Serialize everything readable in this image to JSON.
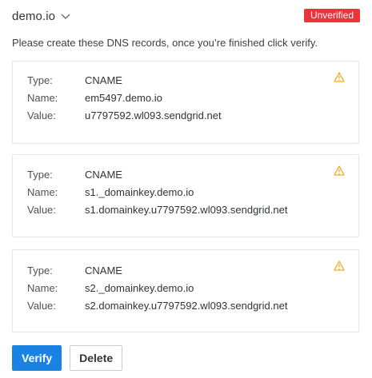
{
  "header": {
    "domain": "demo.io",
    "status_badge": "Unverified",
    "status_color": "#e8343a"
  },
  "instructions": "Please create these DNS records, once you’re finished click verify.",
  "labels": {
    "type": "Type:",
    "name": "Name:",
    "value": "Value:"
  },
  "records": [
    {
      "type": "CNAME",
      "name": "em5497.demo.io",
      "value": "u7797592.wl093.sendgrid.net",
      "warning_icon": "warning-triangle"
    },
    {
      "type": "CNAME",
      "name": "s1._domainkey.demo.io",
      "value": "s1.domainkey.u7797592.wl093.sendgrid.net",
      "warning_icon": "warning-triangle"
    },
    {
      "type": "CNAME",
      "name": "s2._domainkey.demo.io",
      "value": "s2.domainkey.u7797592.wl093.sendgrid.net",
      "warning_icon": "warning-triangle"
    }
  ],
  "actions": {
    "verify_label": "Verify",
    "delete_label": "Delete",
    "primary_color": "#1a82e2"
  }
}
